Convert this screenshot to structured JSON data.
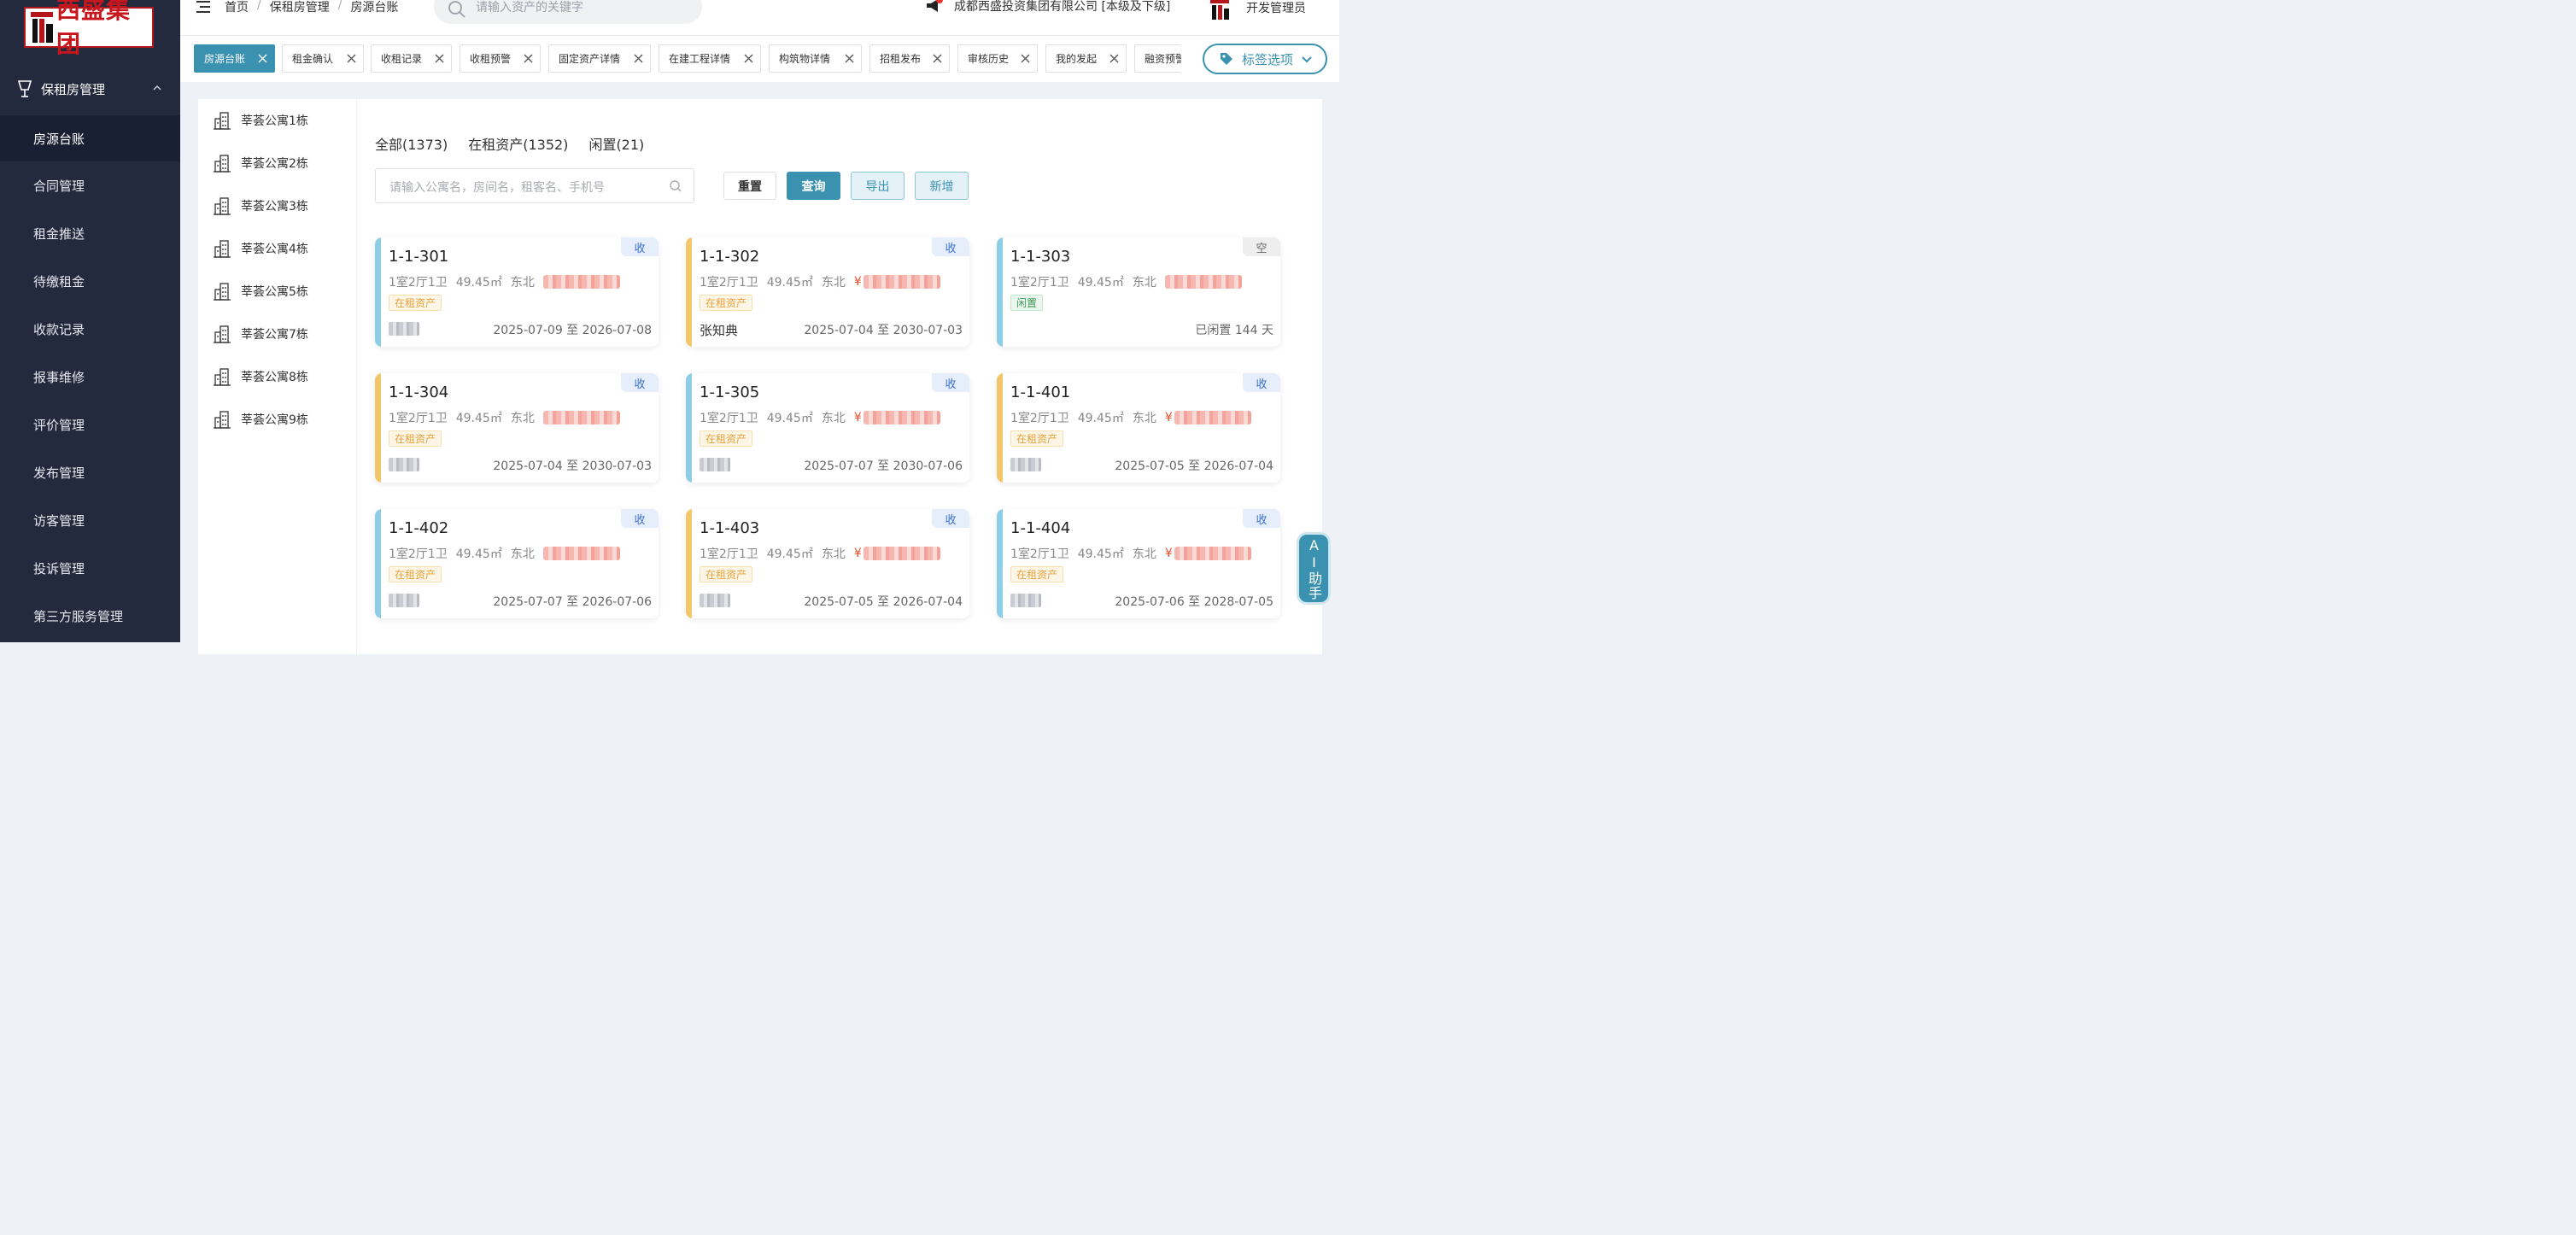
{
  "brand": {
    "logo_text": "西盛集团",
    "primary": "#3a92b0",
    "sidebar_bg": "#232a3d"
  },
  "sidebar": {
    "group_label": "保租房管理",
    "items": [
      "房源台账",
      "合同管理",
      "租金推送",
      "待缴租金",
      "收款记录",
      "报事维修",
      "评价管理",
      "发布管理",
      "访客管理",
      "投诉管理",
      "第三方服务管理"
    ],
    "active_index": 0
  },
  "header": {
    "breadcrumb": [
      "首页",
      "保租房管理",
      "房源台账"
    ],
    "search_placeholder": "请输入资产的关键字",
    "company": "成都西盛投资集团有限公司 [本级及下级]",
    "user": "开发管理员"
  },
  "tags": {
    "items": [
      "房源台账",
      "租金确认",
      "收租记录",
      "收租预警",
      "固定资产详情",
      "在建工程详情",
      "构筑物详情",
      "招租发布",
      "审核历史",
      "我的发起",
      "融资预警"
    ],
    "active_index": 0,
    "options_label": "标签选项"
  },
  "tree": {
    "items": [
      "莘荟公寓1栋",
      "莘荟公寓2栋",
      "莘荟公寓3栋",
      "莘荟公寓4栋",
      "莘荟公寓5栋",
      "莘荟公寓7栋",
      "莘荟公寓8栋",
      "莘荟公寓9栋"
    ]
  },
  "filters": {
    "all": "全部(1373)",
    "rented": "在租资产(1352)",
    "idle": "闲置(21)"
  },
  "search": {
    "placeholder": "请输入公寓名，房间名，租客名、手机号"
  },
  "buttons": {
    "reset": "重置",
    "query": "查询",
    "export": "导出",
    "add": "新增"
  },
  "cards": [
    {
      "room": "1-1-301",
      "layout": "1室2厅1卫",
      "area": "49.45㎡",
      "orient": "东北",
      "corner": "收",
      "status": "在租资产",
      "tenant": "",
      "dates": "2025-07-09 至 2026-07-08",
      "bar": "#8ecde6",
      "yen": false
    },
    {
      "room": "1-1-302",
      "layout": "1室2厅1卫",
      "area": "49.45㎡",
      "orient": "东北",
      "corner": "收",
      "status": "在租资产",
      "tenant": "张知典",
      "dates": "2025-07-04 至 2030-07-03",
      "bar": "#f4c66a",
      "yen": true
    },
    {
      "room": "1-1-303",
      "layout": "1室2厅1卫",
      "area": "49.45㎡",
      "orient": "东北",
      "corner": "空",
      "status": "闲置",
      "tenant": "",
      "dates": "已闲置 144 天",
      "bar": "#8ecde6",
      "yen": false
    },
    {
      "room": "1-1-304",
      "layout": "1室2厅1卫",
      "area": "49.45㎡",
      "orient": "东北",
      "corner": "收",
      "status": "在租资产",
      "tenant": "",
      "dates": "2025-07-04 至 2030-07-03",
      "bar": "#f4c66a",
      "yen": false
    },
    {
      "room": "1-1-305",
      "layout": "1室2厅1卫",
      "area": "49.45㎡",
      "orient": "东北",
      "corner": "收",
      "status": "在租资产",
      "tenant": "",
      "dates": "2025-07-07 至 2030-07-06",
      "bar": "#8ecde6",
      "yen": true
    },
    {
      "room": "1-1-401",
      "layout": "1室2厅1卫",
      "area": "49.45㎡",
      "orient": "东北",
      "corner": "收",
      "status": "在租资产",
      "tenant": "",
      "dates": "2025-07-05 至 2026-07-04",
      "bar": "#f4c66a",
      "yen": true
    },
    {
      "room": "1-1-402",
      "layout": "1室2厅1卫",
      "area": "49.45㎡",
      "orient": "东北",
      "corner": "收",
      "status": "在租资产",
      "tenant": "",
      "dates": "2025-07-07 至 2026-07-06",
      "bar": "#8ecde6",
      "yen": false
    },
    {
      "room": "1-1-403",
      "layout": "1室2厅1卫",
      "area": "49.45㎡",
      "orient": "东北",
      "corner": "收",
      "status": "在租资产",
      "tenant": "",
      "dates": "2025-07-05 至 2026-07-04",
      "bar": "#f4c66a",
      "yen": true
    },
    {
      "room": "1-1-404",
      "layout": "1室2厅1卫",
      "area": "49.45㎡",
      "orient": "东北",
      "corner": "收",
      "status": "在租资产",
      "tenant": "",
      "dates": "2025-07-06 至 2028-07-05",
      "bar": "#8ecde6",
      "yen": true
    }
  ],
  "ai_assistant": {
    "label": "AI助手"
  }
}
